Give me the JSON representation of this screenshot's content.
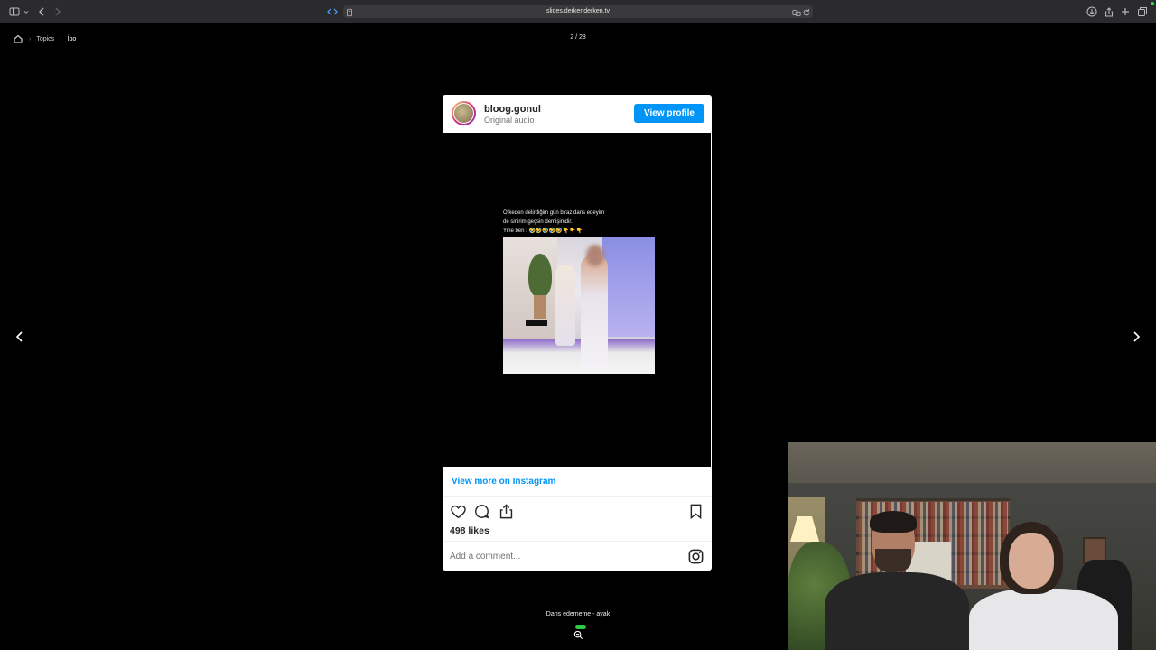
{
  "browser": {
    "url": "slides.derkenderken.tv"
  },
  "breadcrumb": {
    "items": [
      "Topics",
      "İbo"
    ]
  },
  "slide": {
    "counter": "2 / 28",
    "caption": "Dans edememe - ayak"
  },
  "instagram": {
    "username": "bloog.gonul",
    "audio": "Original audio",
    "view_profile": "View profile",
    "caption_lines": [
      "Öfkeden delirdiğim gün biraz dans edeyim",
      "de sinirim geçsin demişimdir.",
      "Yine ben : 🤣🤣🤣🤣🤣👇👇👇"
    ],
    "view_more": "View more on Instagram",
    "likes": "498 likes",
    "comment_placeholder": "Add a comment..."
  },
  "colors": {
    "ig_blue": "#0095f6",
    "toolbar_bg": "#2b2b2d",
    "zoom_badge": "#2ecc40"
  }
}
